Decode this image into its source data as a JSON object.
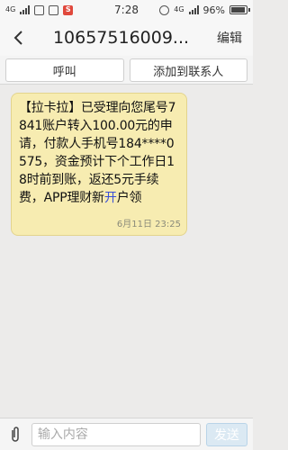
{
  "status_bar": {
    "net1": "4G",
    "net2": "4G",
    "time": "7:28",
    "battery_percent": "96%",
    "app_badge": "S"
  },
  "title_bar": {
    "title": "10657516009...",
    "edit_label": "编辑",
    "back_icon": "chevron-left-icon"
  },
  "actions": {
    "call_label": "呼叫",
    "add_contact_label": "添加到联系人"
  },
  "message": {
    "text_main": "【拉卡拉】已受理向您尾号7841账户转入100.00元的申请，付款人手机号184****0575，资金预计下个工作日18时前到账，返还5元手续费，APP理财新",
    "text_highlight": "开",
    "text_tail": "户领",
    "timestamp": "6月11日 23:25"
  },
  "composer": {
    "placeholder": "输入内容",
    "send_label": "发送",
    "attach_icon": "paperclip-icon"
  },
  "colors": {
    "bubble_bg": "#f7ecb1",
    "highlight": "#3a4fd7",
    "send_bg": "#dbe9f3"
  }
}
